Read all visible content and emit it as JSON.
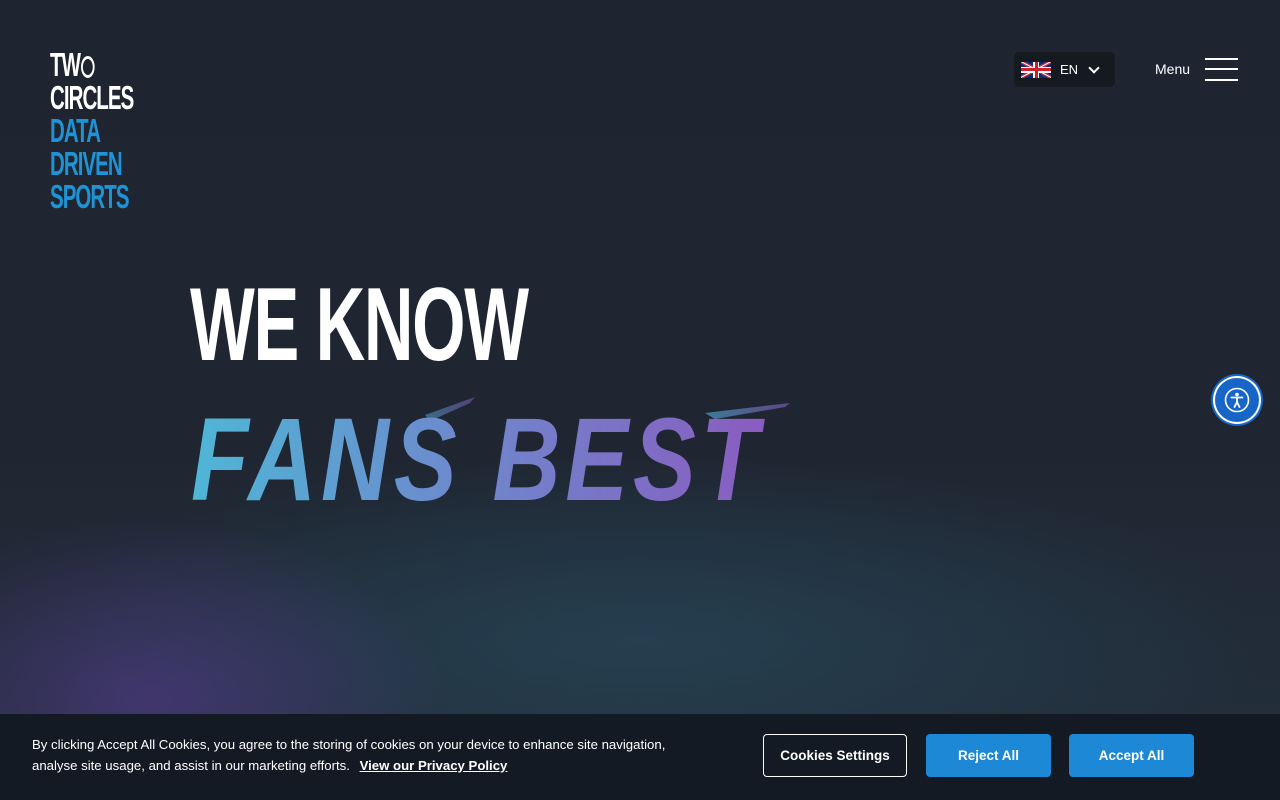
{
  "logo": {
    "line1": "TW",
    "line2": "CIRCLES",
    "line3": "DATA",
    "line4": "DRIVEN",
    "line5": "SPORTS"
  },
  "header": {
    "language": {
      "code": "EN",
      "flag": "uk-flag-icon"
    },
    "menu_label": "Menu"
  },
  "hero": {
    "line1": "WE KNOW",
    "line2": "FANS BEST"
  },
  "cookie_banner": {
    "text": "By clicking Accept All Cookies, you agree to the storing of cookies on your device to enhance site navigation, analyse site usage, and assist in our marketing efforts.",
    "privacy_link": "View our Privacy Policy",
    "settings_label": "Cookies Settings",
    "reject_label": "Reject All",
    "accept_label": "Accept All"
  },
  "colors": {
    "background": "#1f2530",
    "brand_blue": "#1e93d6",
    "gradient_start": "#4fb6d6",
    "gradient_end": "#8a5cc0",
    "button_blue": "#1d88d6"
  }
}
